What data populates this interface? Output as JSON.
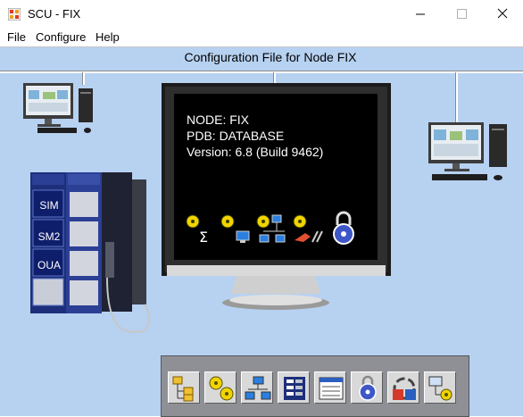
{
  "window": {
    "title": "SCU - FIX",
    "icons": {
      "app": "scu-app-icon",
      "minimize": "minimize-icon",
      "maximize": "maximize-icon",
      "close": "close-icon"
    }
  },
  "menu": {
    "items": [
      {
        "label": "File",
        "name": "file"
      },
      {
        "label": "Configure",
        "name": "configure"
      },
      {
        "label": "Help",
        "name": "help"
      }
    ]
  },
  "main": {
    "title": "Configuration File for Node FIX",
    "screen": {
      "node": "NODE: FIX",
      "pdb": "PDB: DATABASE",
      "version": "Version:  6.8 (Build 9462)",
      "icons": [
        "sigma-task-icon",
        "monitor-task-icon",
        "network-task-icon",
        "alarm-task-icon",
        "security-lock-icon"
      ]
    },
    "plc_modules": [
      "SIM",
      "SM2",
      "OUA"
    ]
  },
  "toolbar": {
    "buttons": [
      "folder-tree-icon",
      "tasks-icon",
      "network-icon",
      "database-icon",
      "alarm-list-icon",
      "security-icon",
      "sql-icon",
      "local-startup-icon"
    ]
  },
  "colors": {
    "client_background": "#b7d1f1",
    "screen": "#000000",
    "toolbar": "#8f9095",
    "plc_panel": "#1d2f7a"
  }
}
